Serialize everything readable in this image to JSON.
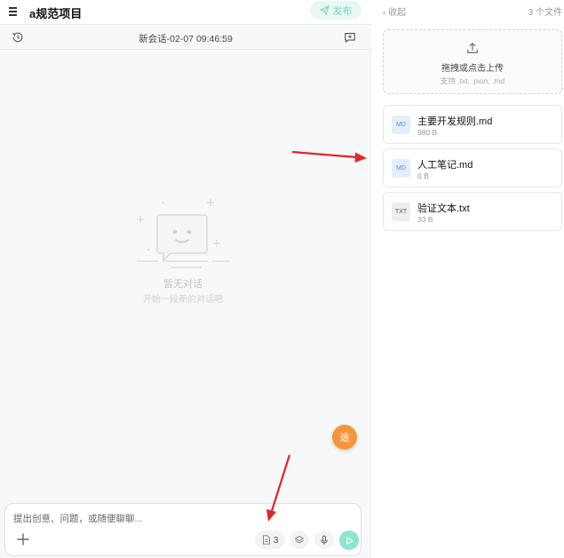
{
  "header": {
    "project_title": "a规范项目",
    "publish_label": "发布"
  },
  "session": {
    "title": "新会话-02-07 09:46:59"
  },
  "empty_state": {
    "title": "暂无对话",
    "subtitle": "开始一段新的对话吧"
  },
  "fab": {
    "label": "途"
  },
  "composer": {
    "placeholder": "提出创意、问题，或随便聊聊...",
    "value": "",
    "file_count": "3"
  },
  "files_panel": {
    "collapse_label": "‹ 收起",
    "count_label": "3 个文件",
    "upload": {
      "title": "拖拽或点击上传",
      "hint": "支持 .txt, .json, .md"
    },
    "files": [
      {
        "badge": "MD",
        "name": "主要开发规则.md",
        "size": "980 B"
      },
      {
        "badge": "MD",
        "name": "人工笔记.md",
        "size": "0 B"
      },
      {
        "badge": "TXT",
        "name": "验证文本.txt",
        "size": "33 B"
      }
    ]
  },
  "colors": {
    "accent": "#8de4d1",
    "publish_bg": "#e7f7f3",
    "fab": "#f7953a",
    "annotation_arrow": "#e0262b"
  },
  "icons": {
    "menu": "hamburger-icon",
    "publish": "send-icon",
    "history": "history-icon",
    "new_chat": "new-chat-icon",
    "upload": "upload-icon",
    "add": "plus-icon",
    "files": "document-icon",
    "layers": "layers-icon",
    "mic": "microphone-icon",
    "send": "play-send-icon"
  }
}
